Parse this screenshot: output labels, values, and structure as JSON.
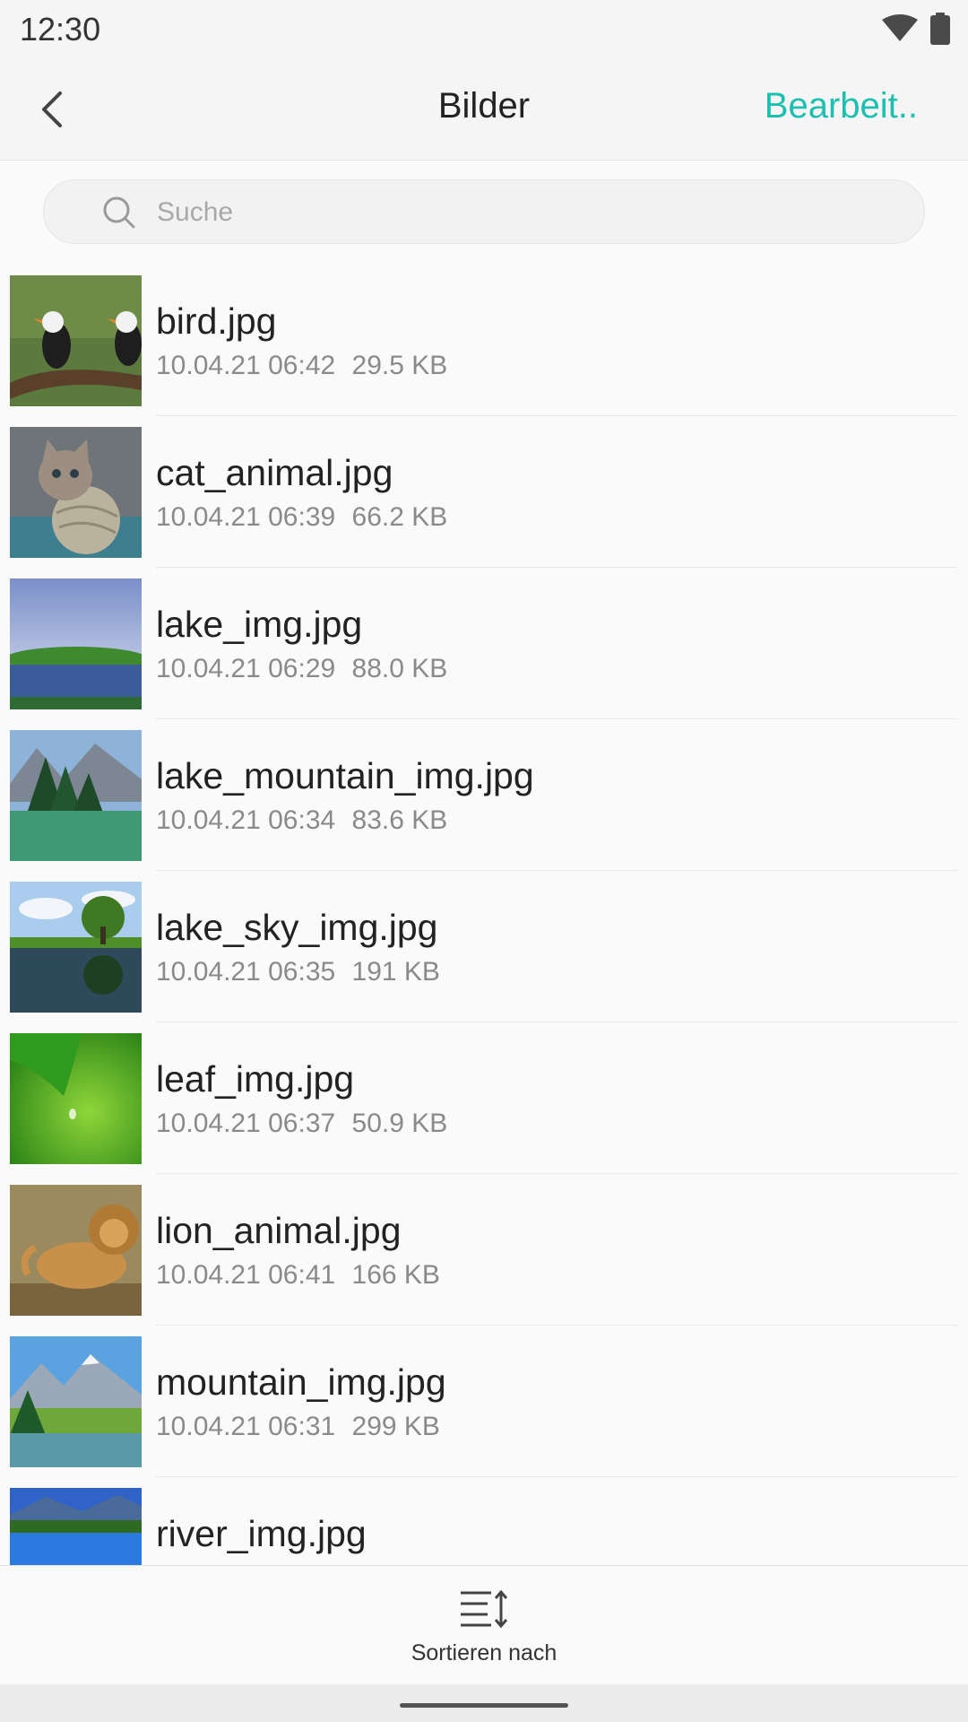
{
  "status_bar": {
    "time": "12:30",
    "icons": [
      "wifi-icon",
      "battery-icon"
    ]
  },
  "header": {
    "back_icon": "chevron-left-icon",
    "title": "Bilder",
    "edit_label": "Bearbeit.."
  },
  "search": {
    "placeholder": "Suche",
    "value": "",
    "icon": "search-icon"
  },
  "files": [
    {
      "name": "bird.jpg",
      "date": "10.04.21 06:42",
      "size": "29.5 KB"
    },
    {
      "name": "cat_animal.jpg",
      "date": "10.04.21 06:39",
      "size": "66.2 KB"
    },
    {
      "name": "lake_img.jpg",
      "date": "10.04.21 06:29",
      "size": "88.0 KB"
    },
    {
      "name": "lake_mountain_img.jpg",
      "date": "10.04.21 06:34",
      "size": "83.6 KB"
    },
    {
      "name": "lake_sky_img.jpg",
      "date": "10.04.21 06:35",
      "size": "191 KB"
    },
    {
      "name": "leaf_img.jpg",
      "date": "10.04.21 06:37",
      "size": "50.9 KB"
    },
    {
      "name": "lion_animal.jpg",
      "date": "10.04.21 06:41",
      "size": "166 KB"
    },
    {
      "name": "mountain_img.jpg",
      "date": "10.04.21 06:31",
      "size": "299 KB"
    },
    {
      "name": "river_img.jpg",
      "date": "",
      "size": ""
    }
  ],
  "bottom_bar": {
    "sort_label": "Sortieren nach",
    "sort_icon": "sort-icon"
  },
  "colors": {
    "accent": "#1cbfb0",
    "background": "#fafafa",
    "header_bg": "#f5f5f5",
    "secondary_text": "#8a8a8a"
  }
}
